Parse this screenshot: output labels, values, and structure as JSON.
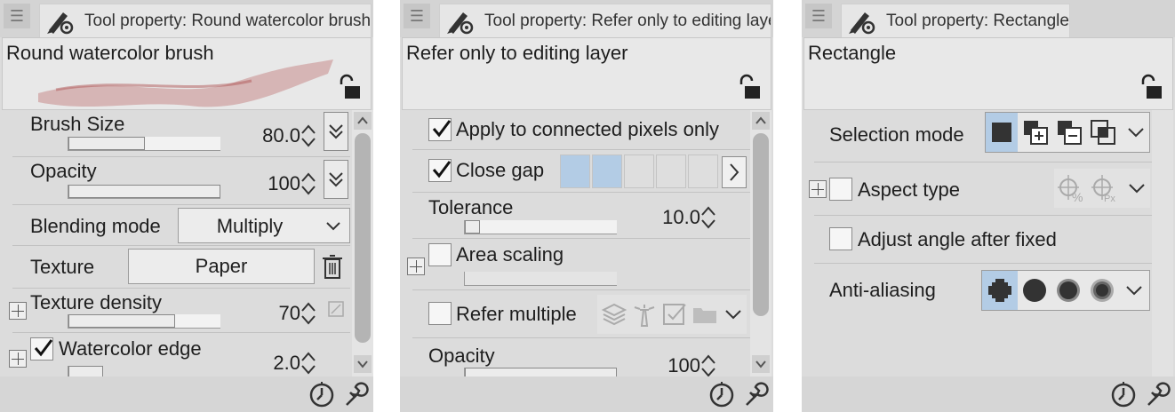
{
  "panels": [
    {
      "tab_title": "Tool property: Round watercolor brush",
      "subtool_name": "Round watercolor brush",
      "brush_size": {
        "label": "Brush Size",
        "value": "80.0",
        "level": 0.5
      },
      "opacity": {
        "label": "Opacity",
        "value": "100",
        "level": 1.0
      },
      "blending_mode": {
        "label": "Blending mode",
        "value": "Multiply"
      },
      "texture": {
        "label": "Texture",
        "value": "Paper"
      },
      "texture_density": {
        "label": "Texture density",
        "value": "70",
        "level": 0.7
      },
      "watercolor_edge": {
        "label": "Watercolor edge",
        "value": "2.0",
        "checked": true
      }
    },
    {
      "tab_title": "Tool property: Refer only to editing layer",
      "subtool_name": "Refer only to editing layer",
      "apply_connected": {
        "label": "Apply to connected pixels only",
        "checked": true
      },
      "close_gap": {
        "label": "Close gap",
        "checked": true,
        "selected_levels": 2,
        "levels": 5
      },
      "tolerance": {
        "label": "Tolerance",
        "value": "10.0",
        "level": 0.1
      },
      "area_scaling": {
        "label": "Area scaling",
        "checked": false
      },
      "refer_multiple": {
        "label": "Refer multiple",
        "checked": false
      },
      "opacity": {
        "label": "Opacity",
        "value": "100"
      }
    },
    {
      "tab_title": "Tool property: Rectangle",
      "subtool_name": "Rectangle",
      "selection_mode": {
        "label": "Selection mode",
        "selected": "new-selection"
      },
      "aspect_type": {
        "label": "Aspect type",
        "checked": false
      },
      "adjust_angle": {
        "label": "Adjust angle after fixed",
        "checked": false
      },
      "anti_aliasing": {
        "label": "Anti-aliasing",
        "selected": "none"
      }
    }
  ],
  "icons": {
    "menu": "hamburger-icon",
    "tool": "pen-gear-icon",
    "lock": "unlock-icon",
    "spin": "up-down-spinner-icon",
    "trash": "trash-icon",
    "footer_left": "timer-icon",
    "footer_right": "wrench-icon"
  },
  "colors": {
    "panel_bg": "#dcdcdc",
    "selected_segment": "#b3cce5",
    "brush_stroke": "#c47a7a"
  }
}
